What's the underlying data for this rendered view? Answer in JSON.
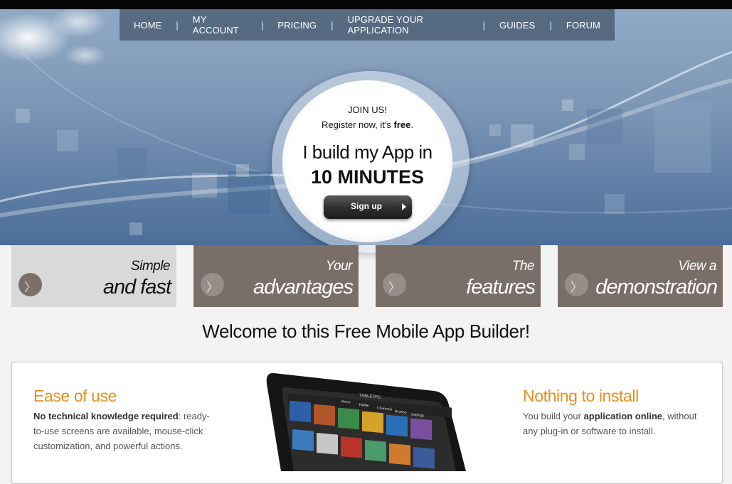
{
  "nav": {
    "items": [
      "HOME",
      "MY ACCOUNT",
      "PRICING",
      "UPGRADE YOUR APPLICATION",
      "GUIDES",
      "FORUM"
    ],
    "separator": "|"
  },
  "hero": {
    "join": "JOIN US!",
    "register_prefix": "Register now, it's ",
    "register_bold": "free",
    "register_suffix": ".",
    "headline": "I build my App in",
    "headline_strong": "10 MINUTES",
    "signup_label": "Sign up"
  },
  "tiles": [
    {
      "line1": "Simple",
      "line2": "and fast",
      "icon": "chevron-right-icon"
    },
    {
      "line1": "Your",
      "line2": "advantages",
      "icon": "chevron-right-icon"
    },
    {
      "line1": "The",
      "line2": "features",
      "icon": "chevron-right-icon"
    },
    {
      "line1": "View a",
      "line2": "demonstration",
      "icon": "chevron-right-icon"
    }
  ],
  "chevron_glyph": "〉",
  "welcome": "Welcome to this Free Mobile App Builder!",
  "features": {
    "left": {
      "title": "Ease of use",
      "bold": "No technical knowledge required",
      "text": ": ready-to-use screens are available, mouse-click customization, and powerful actions."
    },
    "right": {
      "title": "Nothing to install",
      "prefix": "You build your ",
      "bold": "application online",
      "text": ", without any plug-in or software to install."
    }
  },
  "tablet": {
    "brand": "TABLETPC",
    "tabs": [
      "Menu",
      "Home",
      "Channels",
      "Browse",
      "Settings"
    ]
  },
  "colors": {
    "accent_orange": "#e8901e",
    "tile_dark": "#7a6e68",
    "tile_light": "#d9d9d9",
    "nav_bg": "#465a70"
  }
}
